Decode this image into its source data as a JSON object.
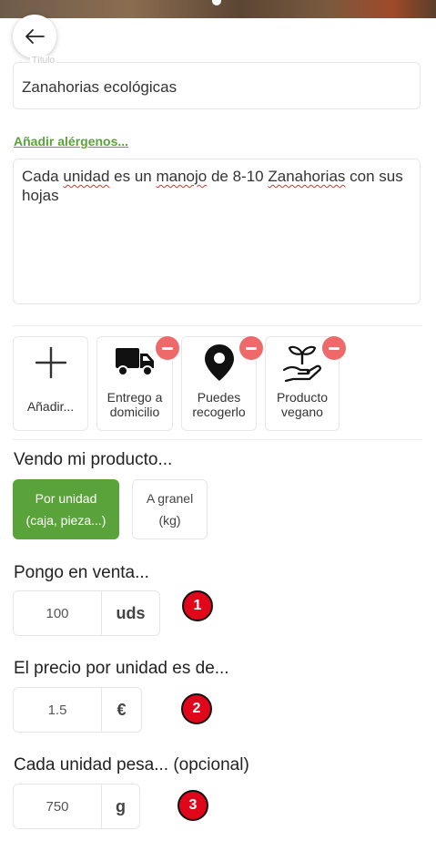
{
  "form": {
    "title_label": "Título",
    "title_value": "Zanahorias ecológicas",
    "allergens_link": "Añadir alérgenos...",
    "description_words": [
      "Cada",
      " ",
      "unidad",
      " es un ",
      "manojo",
      " de 8-10 ",
      "Zanahorias",
      " con sus hojas"
    ]
  },
  "features": {
    "add_label": "Añadir...",
    "items": [
      {
        "label_line1": "Entrego a",
        "label_line2": "domicilio",
        "icon": "truck-icon"
      },
      {
        "label_line1": "Puedes",
        "label_line2": "recogerlo",
        "icon": "map-pin-icon"
      },
      {
        "label_line1": "Producto",
        "label_line2": "vegano",
        "icon": "plant-hand-icon"
      }
    ]
  },
  "sell_mode": {
    "title": "Vendo mi producto...",
    "options": [
      {
        "line1": "Por unidad",
        "line2": "(caja, pieza...)",
        "selected": true
      },
      {
        "line1": "A granel",
        "line2": "(kg)",
        "selected": false
      }
    ]
  },
  "quantity": {
    "title": "Pongo en venta...",
    "value": "100",
    "unit": "uds",
    "badge": "1"
  },
  "price": {
    "title": "El precio por unidad es de...",
    "value": "1.5",
    "unit": "€",
    "badge": "2"
  },
  "weight": {
    "title": "Cada unidad pesa... (opcional)",
    "value": "750",
    "unit": "g",
    "badge": "3"
  },
  "colors": {
    "accent": "#5aa33a",
    "remove": "#ee6a6a",
    "badge": "#e0071b"
  }
}
